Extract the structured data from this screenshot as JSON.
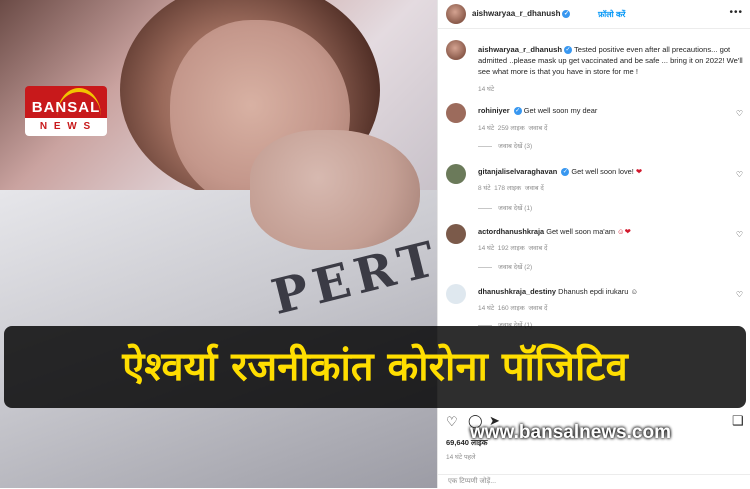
{
  "logo": {
    "brand": "BANSAL",
    "sub": "N E W S"
  },
  "post": {
    "header_username": "aishwaryaa_r_dhanush",
    "follow_label": "फ़ॉलो करें",
    "caption_username": "aishwaryaa_r_dhanush",
    "caption_text": "Tested positive even after all precautions... got admitted ..please mask up get vaccinated and be safe ... bring it on 2022! We'll see what more is that you have in store for me !",
    "caption_time": "14 घंटे",
    "likes": "69,640 लाइक",
    "ago": "14 घंटे पहले",
    "add_comment_placeholder": "एक टिप्पणी जोड़ें..."
  },
  "comments": [
    {
      "user": "rohiniyer",
      "text": "Get well soon my dear",
      "time": "14 घंटे",
      "likes": "259 लाइक",
      "reply": "जवाब दें",
      "views": "जवाब देखें (3)"
    },
    {
      "user": "gitanjaliselvaraghavan",
      "text": "Get well soon love!",
      "time": "8 घंटे",
      "likes": "178 लाइक",
      "reply": "जवाब दें",
      "views": "जवाब देखें (1)"
    },
    {
      "user": "actordhanushkraja",
      "text": "Get well soon ma'am",
      "time": "14 घंटे",
      "likes": "192 लाइक",
      "reply": "जवाब दें",
      "views": "जवाब देखें (2)"
    },
    {
      "user": "dhanushkraja_destiny",
      "text": "Dhanush epdi irukaru",
      "time": "14 घंटे",
      "likes": "160 लाइक",
      "reply": "जवाब दें",
      "views": "जवाब देखें (1)"
    }
  ],
  "banner": {
    "headline": "ऐश्वर्या रजनीकांत कोरोना पॉजिटिव",
    "website": "www.bansalnews.com"
  },
  "icons": [
    "heart-icon",
    "comment-icon",
    "share-icon",
    "bookmark-icon",
    "more-icon",
    "verified-icon"
  ],
  "colors": {
    "banner_text": "#ffde00",
    "logo_red": "#c8191b",
    "link_blue": "#0095f6"
  }
}
